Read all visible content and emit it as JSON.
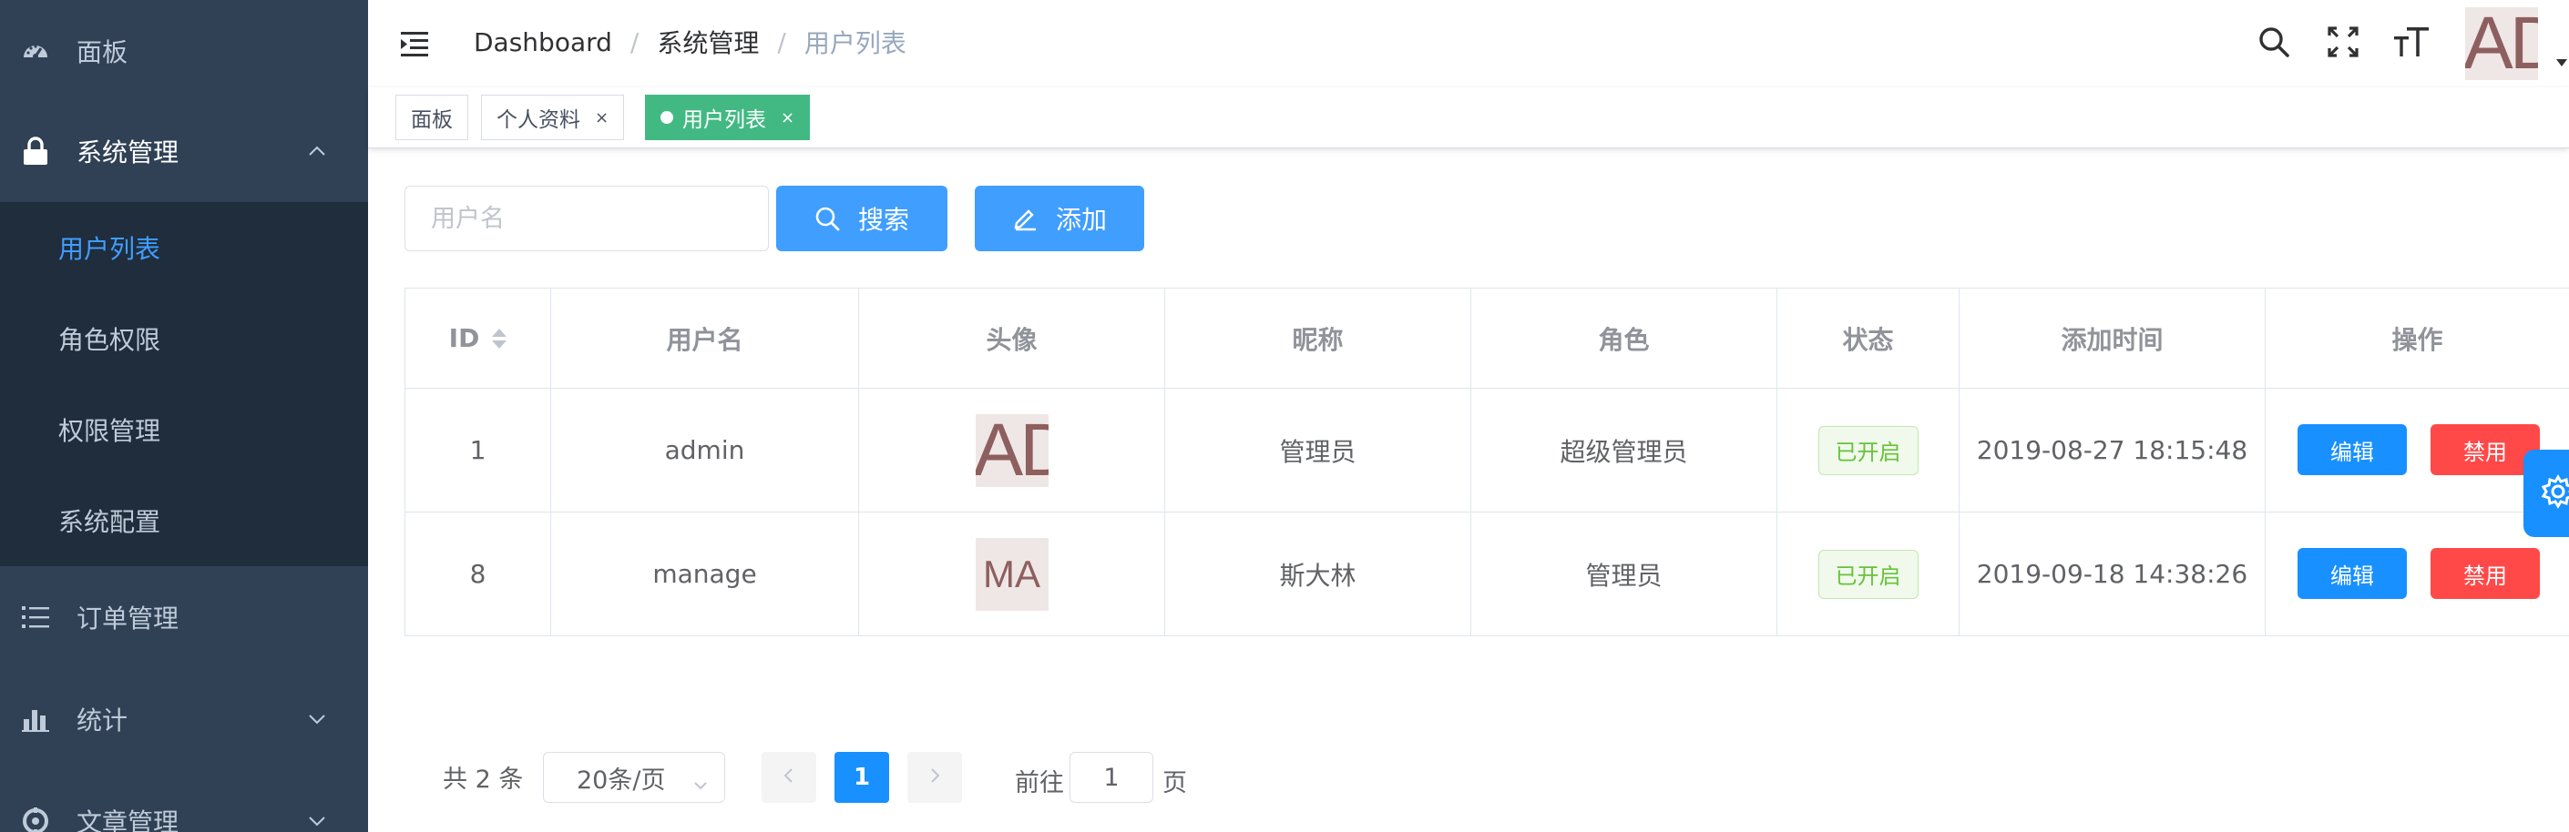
{
  "sidebar": {
    "items": [
      {
        "label": "面板",
        "icon": "dashboard-icon"
      },
      {
        "label": "系统管理",
        "icon": "lock-icon",
        "expanded": true
      },
      {
        "label": "订单管理",
        "icon": "list-icon"
      },
      {
        "label": "统计",
        "icon": "bar-chart-icon"
      },
      {
        "label": "文章管理",
        "icon": "compass-icon"
      }
    ],
    "submenu": [
      {
        "label": "用户列表",
        "active": true
      },
      {
        "label": "角色权限"
      },
      {
        "label": "权限管理"
      },
      {
        "label": "系统配置"
      }
    ]
  },
  "navbar": {
    "breadcrumb": [
      "Dashboard",
      "系统管理",
      "用户列表"
    ],
    "avatar_text": "AD"
  },
  "tags": [
    {
      "label": "面板"
    },
    {
      "label": "个人资料",
      "close": "×"
    },
    {
      "label": "用户列表",
      "close": "×",
      "active": true
    }
  ],
  "filter": {
    "placeholder": "用户名",
    "search_label": "搜索",
    "add_label": "添加"
  },
  "table": {
    "columns": [
      "ID",
      "用户名",
      "头像",
      "昵称",
      "角色",
      "状态",
      "添加时间",
      "操作"
    ],
    "rows": [
      {
        "id": "1",
        "username": "admin",
        "avatar": "AD",
        "nickname": "管理员",
        "role": "超级管理员",
        "status": "已开启",
        "created": "2019-08-27 18:15:48",
        "edit": "编辑",
        "disable": "禁用"
      },
      {
        "id": "8",
        "username": "manage",
        "avatar": "MA",
        "nickname": "斯大林",
        "role": "管理员",
        "status": "已开启",
        "created": "2019-09-18 14:38:26",
        "edit": "编辑",
        "disable": "禁用"
      }
    ]
  },
  "pagination": {
    "total": "共 2 条",
    "page_size": "20条/页",
    "current_page": "1",
    "goto_label": "前往",
    "goto_value": "1",
    "page_unit": "页"
  },
  "colors": {
    "sidebar_bg": "#304156",
    "submenu_bg": "#1f2d3d",
    "accent": "#409eff",
    "tag_active": "#42b983",
    "danger": "#ff4949",
    "success": "#67c23a"
  }
}
